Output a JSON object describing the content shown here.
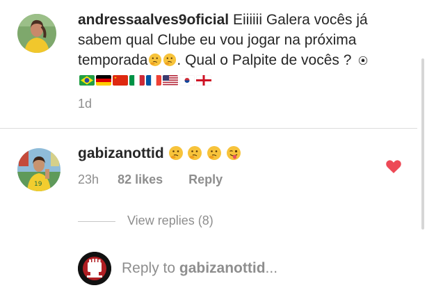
{
  "post": {
    "username": "andressaalves9oficial",
    "caption": "Eiiiiii Galera vocês já sabem qual Clube eu vou jogar na próxima temporada",
    "caption_tail": ". Qual o Palpite de vocês ? ",
    "time": "1d"
  },
  "reply": {
    "username": "gabizanottid",
    "time": "23h",
    "likes": "82 likes",
    "reply_label": "Reply",
    "liked": true,
    "heart_color": "#ed4956"
  },
  "view_replies": "View replies (8)",
  "composer": {
    "prefix": "Reply to ",
    "target": "gabizanottid",
    "suffix": "..."
  },
  "icons": {
    "caption_emojis": [
      "thinking-face",
      "thinking-face"
    ],
    "caption_flags": [
      "soccer-ball",
      "brazil-flag",
      "germany-flag",
      "china-flag",
      "italy-flag",
      "france-flag",
      "usa-flag",
      "south-korea-flag",
      "england-flag"
    ],
    "reply_emojis": [
      "thinking-face",
      "thinking-face",
      "thinking-face",
      "winking-tongue-face"
    ]
  }
}
